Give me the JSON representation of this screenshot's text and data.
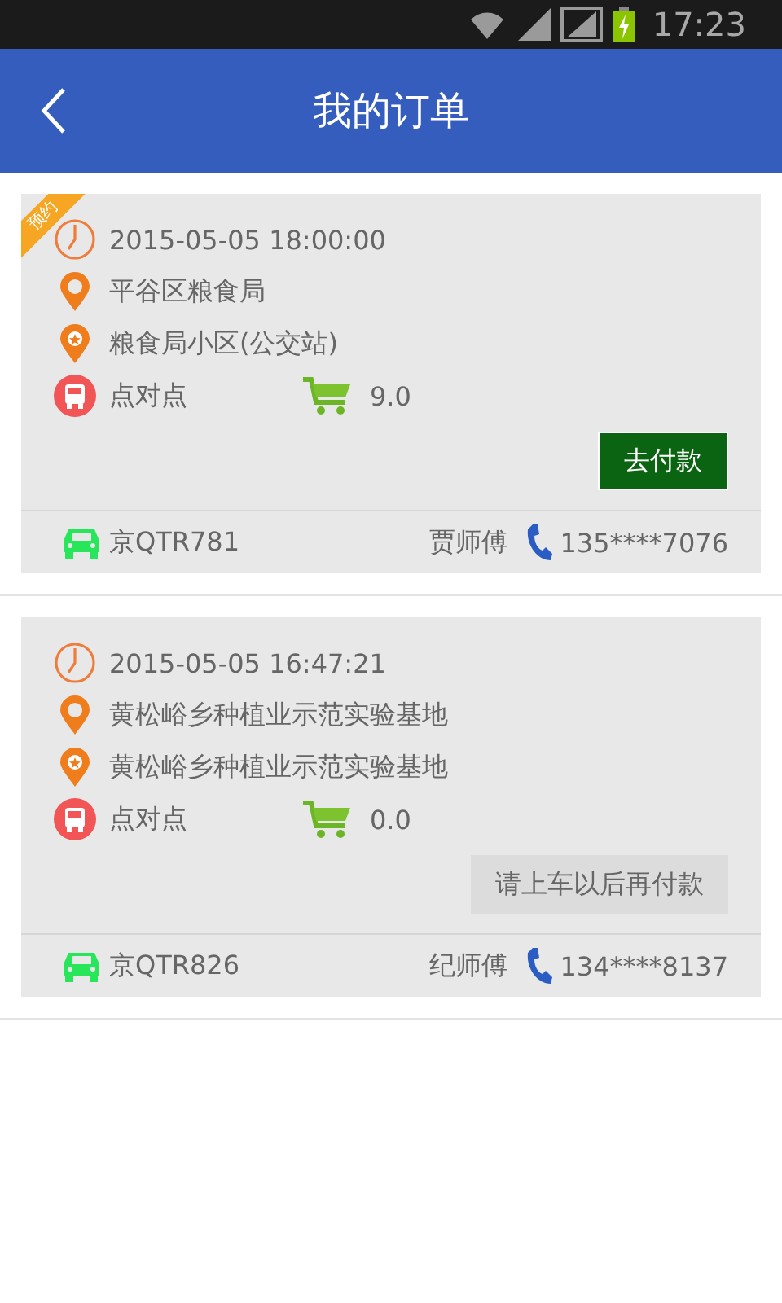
{
  "status_bar": {
    "time": "17:23"
  },
  "header": {
    "title": "我的订单"
  },
  "orders": [
    {
      "badge": "预约",
      "time": "2015-05-05 18:00:00",
      "origin": "平谷区粮食局",
      "destination": "粮食局小区(公交站)",
      "route": "点对点",
      "price": "9.0",
      "pay_button": {
        "label": "去付款",
        "disabled": false
      },
      "plate": "京QTR781",
      "driver": "贾师傅",
      "phone": "135****7076"
    },
    {
      "time": "2015-05-05 16:47:21",
      "origin": "黄松峪乡种植业示范实验基地",
      "destination": "黄松峪乡种植业示范实验基地",
      "route": "点对点",
      "price": "0.0",
      "pay_button": {
        "label": "请上车以后再付款",
        "disabled": true
      },
      "plate": "京QTR826",
      "driver": "纪师傅",
      "phone": "134****8137"
    }
  ]
}
